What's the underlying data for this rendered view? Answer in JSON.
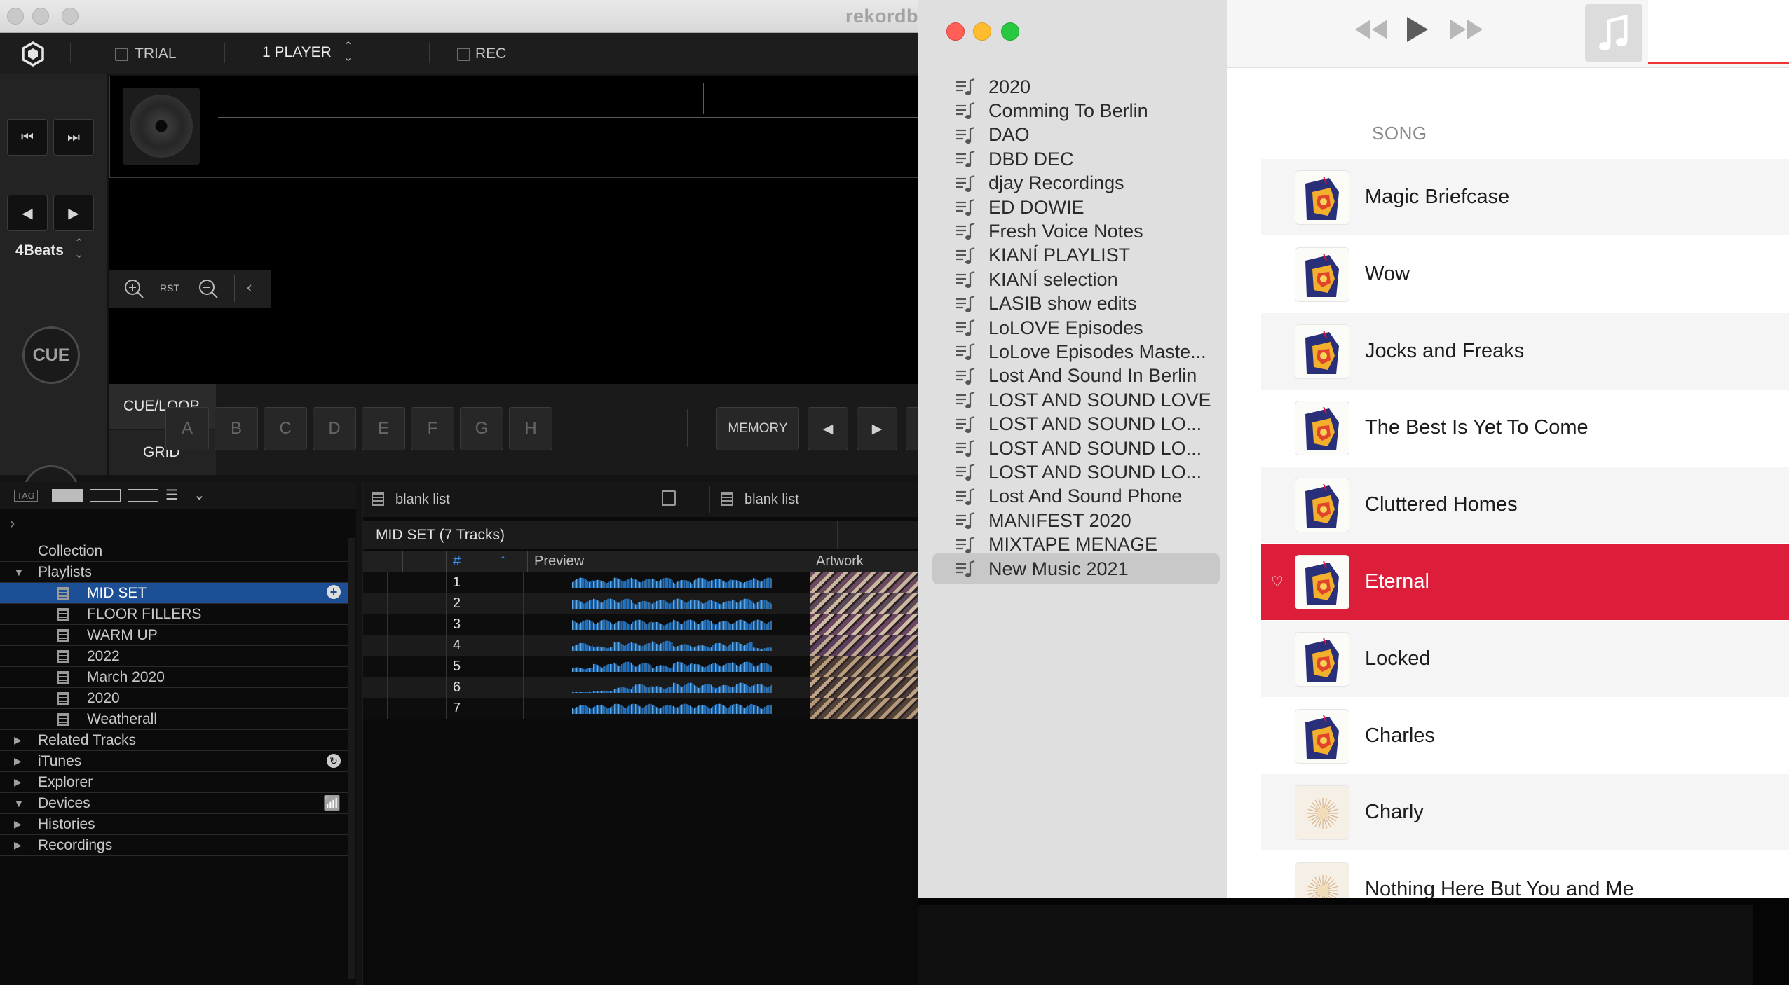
{
  "rekordbox": {
    "title": "rekordb",
    "toolbar": {
      "trial": "TRIAL",
      "player_mode": "1 PLAYER",
      "rec": "REC"
    },
    "beats": "4Beats",
    "cue_label": "CUE",
    "zoom_reset": "RST",
    "tabs": {
      "cue_loop": "CUE/LOOP",
      "grid": "GRID"
    },
    "hot_cues": [
      "A",
      "B",
      "C",
      "D",
      "E",
      "F",
      "G",
      "H"
    ],
    "memory": "MEMORY",
    "tree": {
      "tag": "TAG",
      "collection": "Collection",
      "playlists": "Playlists",
      "playlist_items": [
        "MID SET",
        "FLOOR FILLERS",
        "WARM UP",
        "2022",
        "March 2020",
        "2020",
        "Weatherall"
      ],
      "sections": [
        "Related Tracks",
        "iTunes",
        "Explorer",
        "Devices",
        "Histories",
        "Recordings"
      ]
    },
    "list": {
      "tab1": "blank list",
      "tab2": "blank list",
      "heading": "MID SET (7 Tracks)",
      "col_num": "#",
      "col_preview": "Preview",
      "col_artwork": "Artwork",
      "tracks": [
        "1",
        "2",
        "3",
        "4",
        "5",
        "6",
        "7"
      ]
    }
  },
  "music": {
    "playlists": [
      "2020",
      "Comming To Berlin",
      "DAO",
      "DBD DEC",
      "djay Recordings",
      "ED DOWIE",
      "Fresh Voice Notes",
      "KIANÍ PLAYLIST",
      "KIANÍ selection",
      "LASIB show edits",
      "LoLOVE Episodes",
      "LoLove Episodes Maste...",
      "Lost And Sound In Berlin",
      "LOST AND SOUND LOVE",
      "LOST AND SOUND LO...",
      "LOST AND SOUND LO...",
      "LOST AND SOUND LO...",
      "Lost And Sound Phone",
      "MANIFEST 2020",
      "MIXTAPE MENAGE",
      "New Music 2021"
    ],
    "selected_playlist": "New Music 2021",
    "song_header": "SONG",
    "songs": [
      "Magic Briefcase",
      "Wow",
      "Jocks and Freaks",
      "The Best Is Yet To Come",
      "Cluttered Homes",
      "Eternal",
      "Locked",
      "Charles",
      "Charly",
      "Nothing Here But You and Me"
    ],
    "selected_song": "Eternal",
    "accent": "#dc1e3b"
  }
}
